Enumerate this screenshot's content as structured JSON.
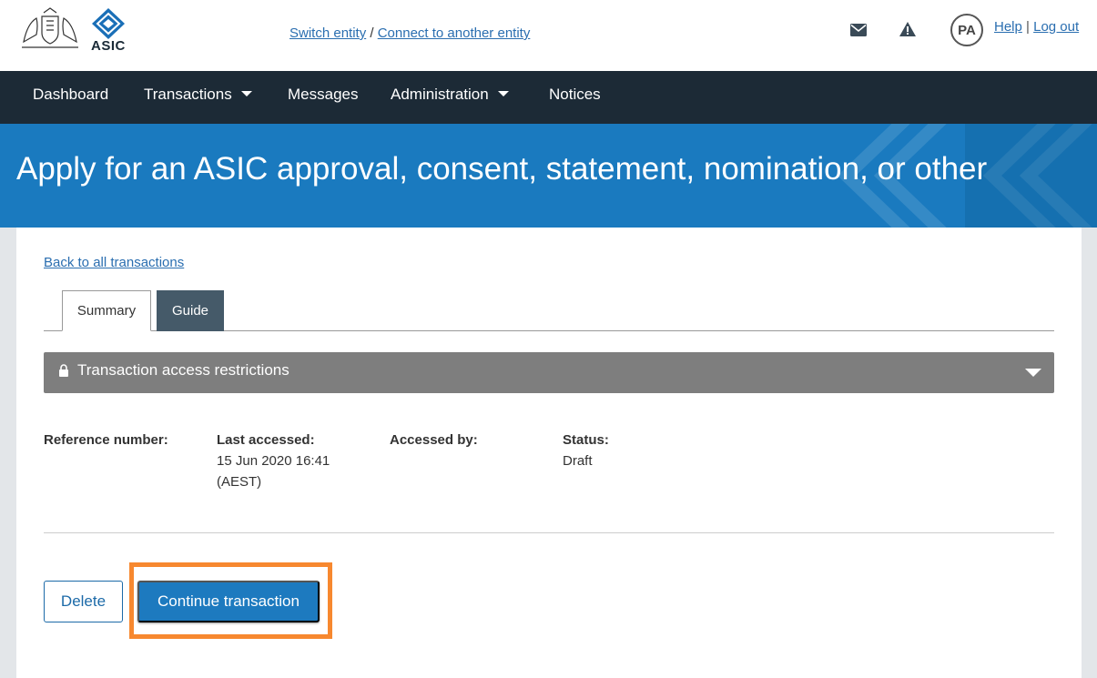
{
  "header": {
    "crest_alt": "Commonwealth Coat of Arms",
    "logo_text": "ASIC",
    "switch_entity": "Switch entity",
    "separator": "/",
    "connect_entity": "Connect to another entity",
    "mail_icon": "envelope-icon",
    "alert_icon": "warning-triangle-icon",
    "avatar_initials": "PA",
    "help": "Help",
    "help_sep": "|",
    "logout": "Log out"
  },
  "nav": {
    "items": [
      {
        "label": "Dashboard",
        "dropdown": false
      },
      {
        "label": "Transactions",
        "dropdown": true
      },
      {
        "label": "Messages",
        "dropdown": false
      },
      {
        "label": "Administration",
        "dropdown": true
      },
      {
        "label": "Notices",
        "dropdown": false
      }
    ]
  },
  "hero": {
    "title": "Apply for an ASIC approval, consent, statement, nomination, or other"
  },
  "main": {
    "back_link": "Back to all transactions",
    "tabs": [
      {
        "label": "Summary",
        "active": true
      },
      {
        "label": "Guide",
        "active": false
      }
    ],
    "restrictions": {
      "label": "Transaction access restrictions",
      "icon": "lock-icon",
      "expanded": false
    },
    "info": {
      "reference": {
        "label": "Reference number:",
        "value": ""
      },
      "last_accessed": {
        "label": "Last accessed:",
        "value_line1": "15 Jun 2020 16:41",
        "value_line2": "(AEST)"
      },
      "accessed_by": {
        "label": "Accessed by:",
        "value": ""
      },
      "status": {
        "label": "Status:",
        "value": "Draft"
      }
    },
    "buttons": {
      "delete": "Delete",
      "continue": "Continue transaction"
    }
  },
  "colors": {
    "nav_bg": "#1c2a36",
    "hero_bg": "#1a7abf",
    "primary": "#1d7abf",
    "highlight": "#f7882f",
    "restrict_bg": "#7e7e7e",
    "tab_guide_bg": "#455a69"
  }
}
